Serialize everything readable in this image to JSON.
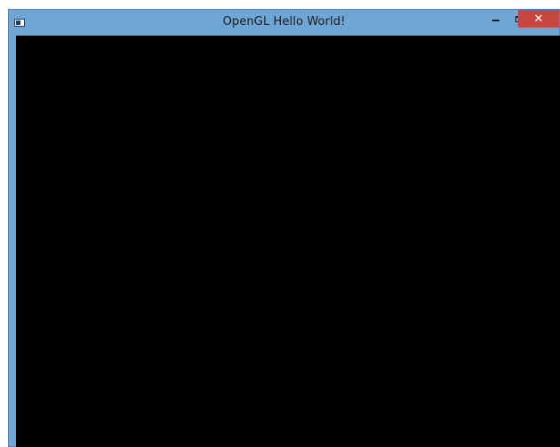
{
  "window": {
    "title": "OpenGL Hello World!",
    "controls": {
      "minimize_glyph": "",
      "maximize_glyph": "",
      "close_glyph": "✕"
    },
    "icons": {
      "app": "application-window-icon",
      "minimize": "minimize-icon",
      "maximize": "maximize-icon",
      "close": "close-icon"
    }
  },
  "colors": {
    "frame": "#6fa6d6",
    "close_button": "#c7473f",
    "client_area": "#000000"
  }
}
